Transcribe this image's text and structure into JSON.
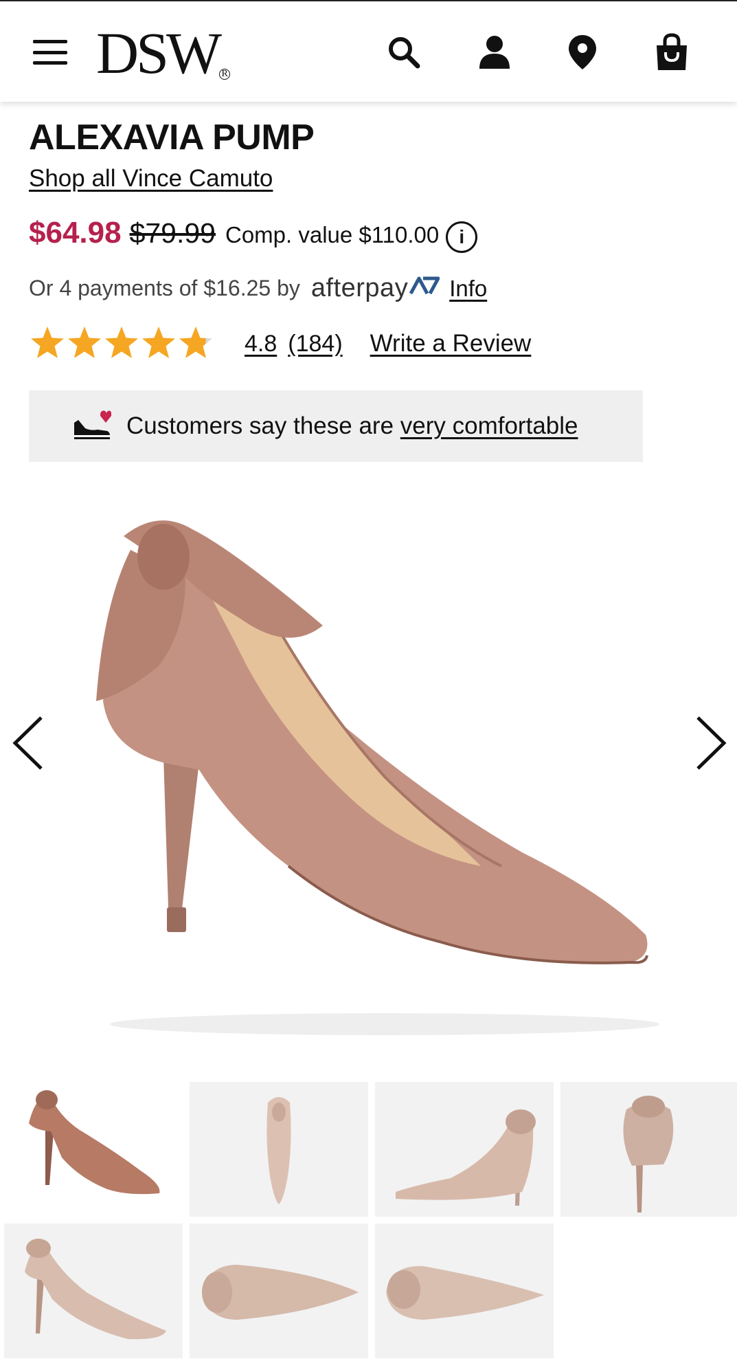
{
  "header": {
    "logo_text": "DSW",
    "logo_reg": "R",
    "icons": [
      "menu-icon",
      "search-icon",
      "account-icon",
      "location-pin-icon",
      "shopping-bag-icon"
    ]
  },
  "product": {
    "title": "ALEXAVIA PUMP",
    "brand_link": "Shop all Vince Camuto",
    "price_sale": "$64.98",
    "price_original": "$79.99",
    "comp_value": "Comp. value $110.00",
    "info_glyph": "i",
    "payments_text": "Or 4 payments of $16.25 by",
    "afterpay_brand": "afterpay",
    "afterpay_info": "Info",
    "rating": "4.8",
    "rating_count": "(184)",
    "rating_fraction": 0.96,
    "write_review": "Write a Review",
    "comfort_prefix": "Customers say these are ",
    "comfort_link": "very comfortable"
  },
  "gallery": {
    "thumbnail_count": 7
  },
  "colors": {
    "sale_price": "#b5214e",
    "star": "#f5a623",
    "comfort_bg": "#efefef",
    "thumb_bg": "#f2f2f2",
    "suede": "#c49282",
    "afterpay_accent": "#2d5a8c"
  }
}
